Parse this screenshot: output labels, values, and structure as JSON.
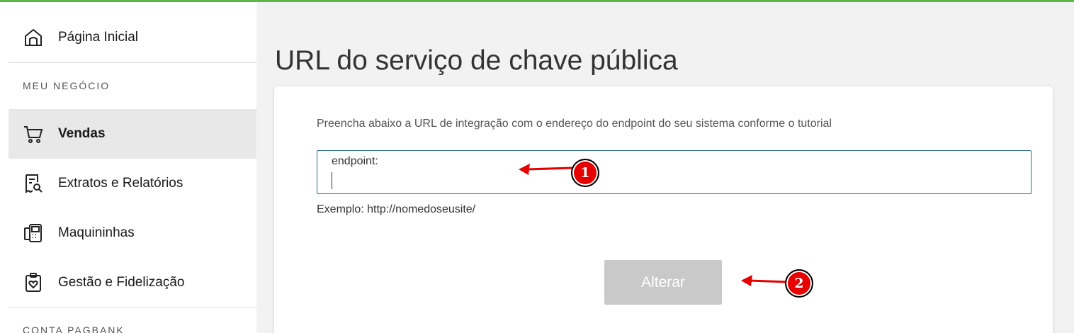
{
  "sidebar": {
    "home": {
      "label": "Página Inicial",
      "icon": "home-icon"
    },
    "section_business": "MEU NEGÓCIO",
    "items": [
      {
        "label": "Vendas",
        "icon": "cart-icon",
        "active": true
      },
      {
        "label": "Extratos e Relatórios",
        "icon": "report-search-icon",
        "active": false
      },
      {
        "label": "Maquininhas",
        "icon": "card-machine-icon",
        "active": false
      },
      {
        "label": "Gestão e Fidelização",
        "icon": "clipboard-heart-icon",
        "active": false
      }
    ],
    "section_account": "CONTA PAGBANK"
  },
  "main": {
    "title": "URL do serviço de chave pública",
    "instructions": "Preencha abaixo a URL de integração com o endereço do endpoint do seu sistema conforme o tutorial",
    "endpoint_label": "endpoint:",
    "endpoint_value": "",
    "example": "Exemplo: http://nomedoseusite/",
    "submit_label": "Alterar"
  },
  "annotations": {
    "badge_1": "1",
    "badge_2": "2"
  },
  "colors": {
    "accent_top": "#5ab646",
    "annotation_red": "#e60000",
    "disabled_button": "#c9c9c9",
    "field_border": "#2c6c8a"
  }
}
